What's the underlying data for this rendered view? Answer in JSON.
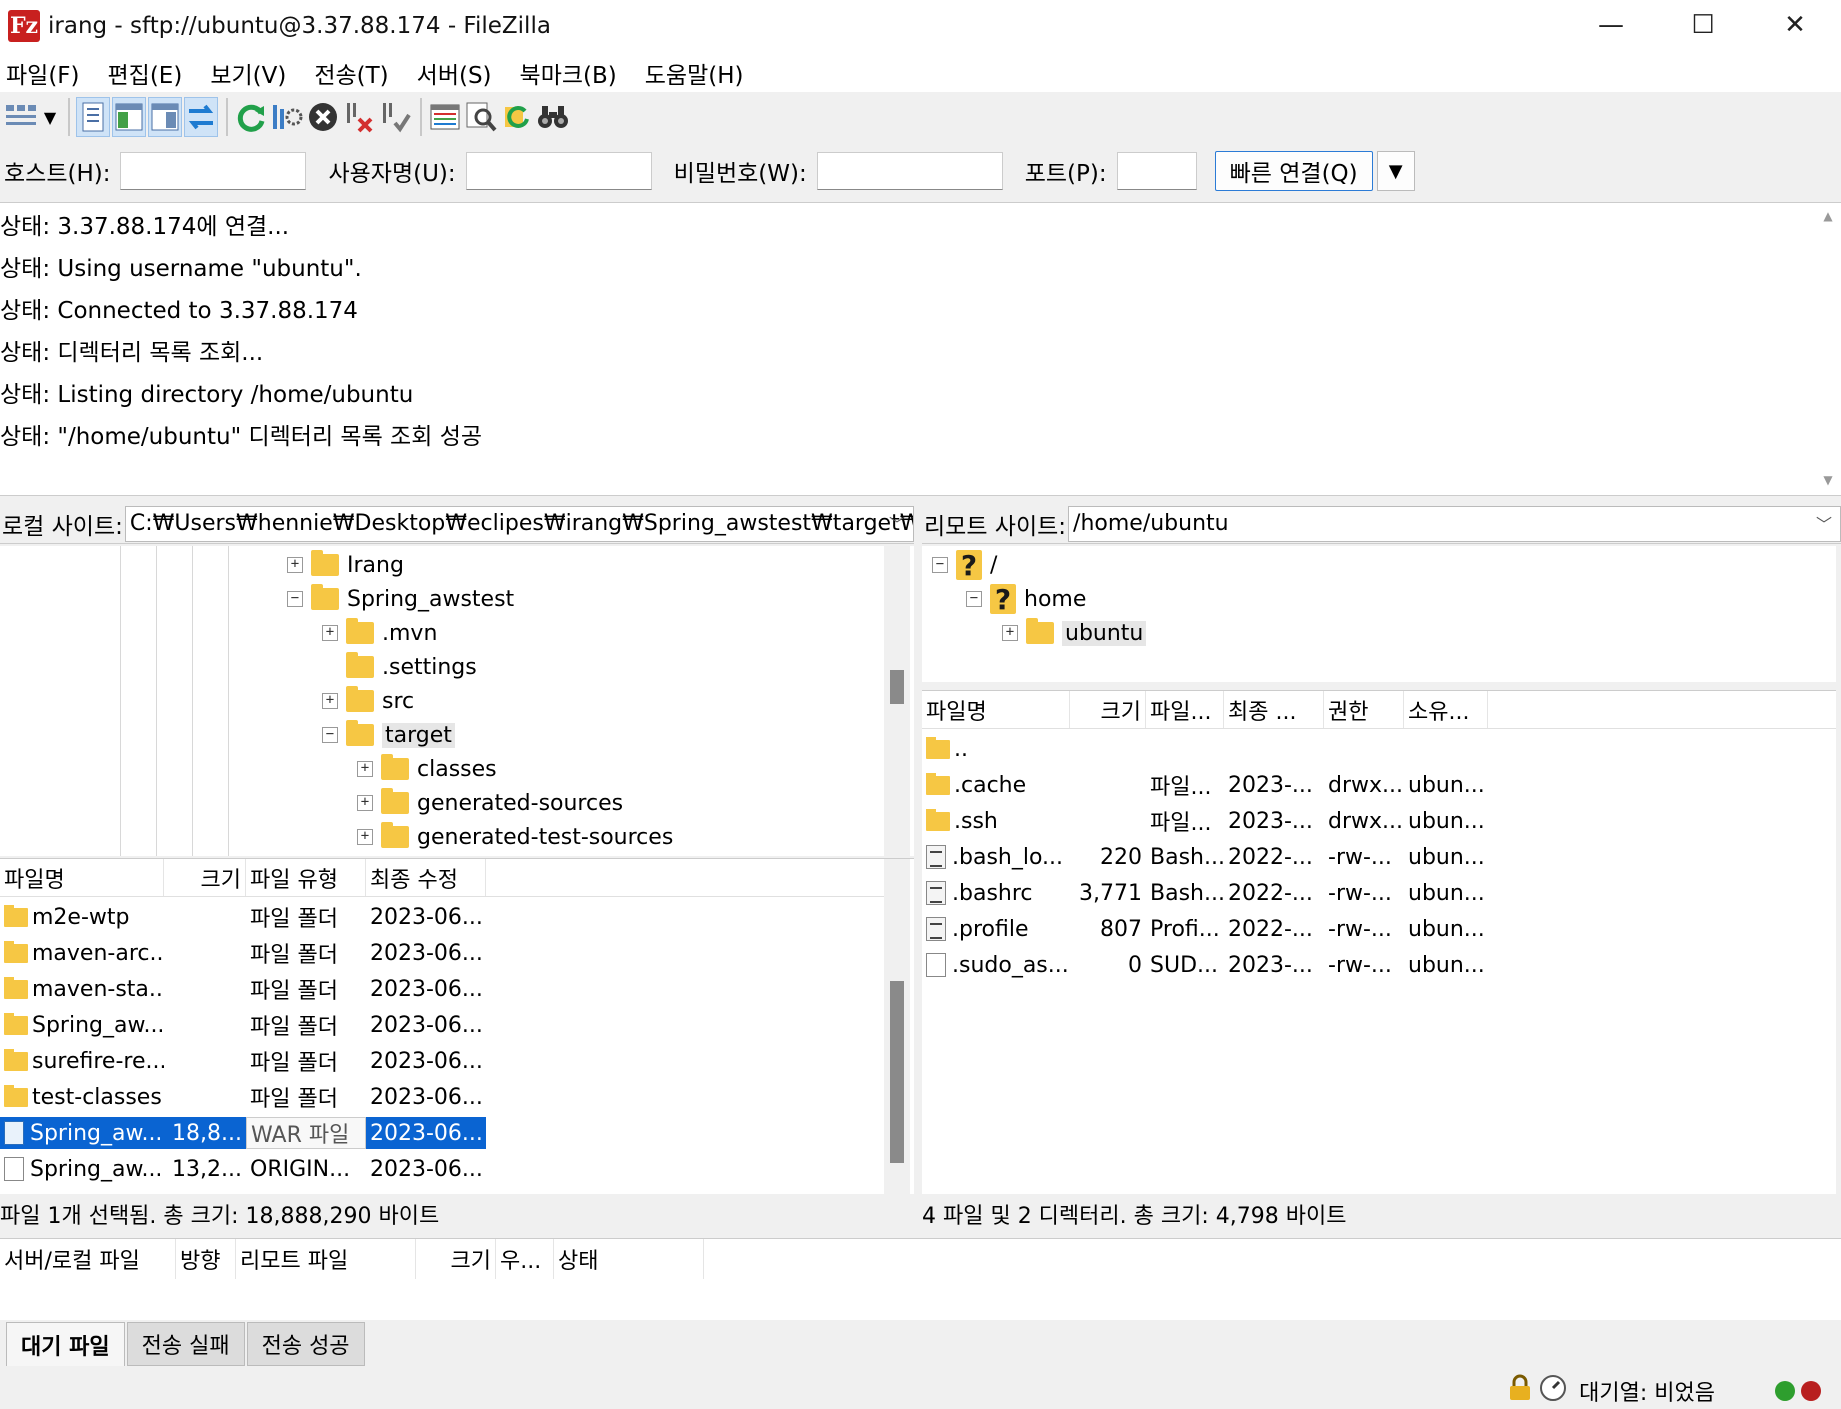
{
  "window": {
    "app_icon": "Fz",
    "title": "irang - sftp://ubuntu@3.37.88.174 - FileZilla",
    "minimize": "—",
    "maximize": "☐",
    "close": "✕"
  },
  "menu": [
    "파일(F)",
    "편집(E)",
    "보기(V)",
    "전송(T)",
    "서버(S)",
    "북마크(B)",
    "도움말(H)"
  ],
  "toolbar": {
    "icons": [
      "site-manager-icon",
      "dropdown-icon",
      "message-log-toggle-icon",
      "local-tree-toggle-icon",
      "remote-tree-toggle-icon",
      "transfer-queue-toggle-icon",
      "refresh-icon",
      "process-queue-icon",
      "cancel-icon",
      "disconnect-icon",
      "reconnect-icon",
      "directory-filter-icon",
      "toggle-comparison-icon",
      "sync-browsing-icon",
      "search-icon"
    ]
  },
  "quickconnect": {
    "host_label": "호스트(H):",
    "user_label": "사용자명(U):",
    "pass_label": "비밀번호(W):",
    "port_label": "포트(P):",
    "host_value": "",
    "user_value": "",
    "pass_value": "",
    "port_value": "",
    "button_label": "빠른 연결(Q)",
    "dropdown": "▼"
  },
  "log": [
    "상태: 3.37.88.174에 연결...",
    "상태: Using username \"ubuntu\".",
    "상태: Connected to 3.37.88.174",
    "상태: 디렉터리 목록 조회...",
    "상태: Listing directory /home/ubuntu",
    "상태: \"/home/ubuntu\" 디렉터리 목록 조회 성공"
  ],
  "local": {
    "site_label": "로컬 사이트:",
    "path": "C:₩Users₩hennie₩Desktop₩eclipes₩irang₩Spring_awstest₩target₩",
    "tree": [
      {
        "label": "Irang",
        "expander": "+"
      },
      {
        "label": "Spring_awstest",
        "expander": "−"
      },
      {
        "label": ".mvn",
        "expander": "+"
      },
      {
        "label": ".settings",
        "expander": ""
      },
      {
        "label": "src",
        "expander": "+"
      },
      {
        "label": "target",
        "expander": "−"
      },
      {
        "label": "classes",
        "expander": "+"
      },
      {
        "label": "generated-sources",
        "expander": "+"
      },
      {
        "label": "generated-test-sources",
        "expander": "+"
      }
    ],
    "columns": [
      "파일명",
      "크기",
      "파일 유형",
      "최종 수정"
    ],
    "files": [
      {
        "name": "m2e-wtp",
        "size": "",
        "type": "파일 폴더",
        "modified": "2023-06...",
        "icon": "folder"
      },
      {
        "name": "maven-arc...",
        "size": "",
        "type": "파일 폴더",
        "modified": "2023-06...",
        "icon": "folder"
      },
      {
        "name": "maven-sta...",
        "size": "",
        "type": "파일 폴더",
        "modified": "2023-06...",
        "icon": "folder"
      },
      {
        "name": "Spring_aw...",
        "size": "",
        "type": "파일 폴더",
        "modified": "2023-06...",
        "icon": "folder"
      },
      {
        "name": "surefire-re...",
        "size": "",
        "type": "파일 폴더",
        "modified": "2023-06...",
        "icon": "folder"
      },
      {
        "name": "test-classes",
        "size": "",
        "type": "파일 폴더",
        "modified": "2023-06...",
        "icon": "folder"
      },
      {
        "name": "Spring_aw...",
        "size": "18,8...",
        "type": "WAR 파일",
        "modified": "2023-06...",
        "icon": "war-file",
        "selected": true
      },
      {
        "name": "Spring_aw...",
        "size": "13,2...",
        "type": "ORIGIN...",
        "modified": "2023-06...",
        "icon": "file"
      }
    ],
    "status": "파일 1개 선택됨. 총 크기: 18,888,290 바이트"
  },
  "remote": {
    "site_label": "리모트 사이트:",
    "path": "/home/ubuntu",
    "tree": [
      {
        "label": "/",
        "expander": "−",
        "icon": "unknown"
      },
      {
        "label": "home",
        "expander": "−",
        "icon": "unknown"
      },
      {
        "label": "ubuntu",
        "expander": "+",
        "icon": "folder"
      }
    ],
    "columns": [
      "파일명",
      "크기",
      "파일...",
      "최종 ...",
      "권한",
      "소유..."
    ],
    "files": [
      {
        "name": "..",
        "size": "",
        "type": "",
        "modified": "",
        "perm": "",
        "owner": "",
        "icon": "folder"
      },
      {
        "name": ".cache",
        "size": "",
        "type": "파일...",
        "modified": "2023-...",
        "perm": "drwx...",
        "owner": "ubun...",
        "icon": "folder"
      },
      {
        "name": ".ssh",
        "size": "",
        "type": "파일...",
        "modified": "2023-...",
        "perm": "drwx...",
        "owner": "ubun...",
        "icon": "folder"
      },
      {
        "name": ".bash_lo...",
        "size": "220",
        "type": "Bash...",
        "modified": "2022-...",
        "perm": "-rw-...",
        "owner": "ubun...",
        "icon": "text-file"
      },
      {
        "name": ".bashrc",
        "size": "3,771",
        "type": "Bash...",
        "modified": "2022-...",
        "perm": "-rw-...",
        "owner": "ubun...",
        "icon": "text-file"
      },
      {
        "name": ".profile",
        "size": "807",
        "type": "Profi...",
        "modified": "2022-...",
        "perm": "-rw-...",
        "owner": "ubun...",
        "icon": "text-file"
      },
      {
        "name": ".sudo_as...",
        "size": "0",
        "type": "SUD...",
        "modified": "2023-...",
        "perm": "-rw-...",
        "owner": "ubun...",
        "icon": "file"
      }
    ],
    "status": "4 파일 및 2 디렉터리. 총 크기: 4,798 바이트"
  },
  "queue": {
    "columns": [
      "서버/로컬 파일",
      "방향",
      "리모트 파일",
      "크기",
      "우...",
      "상태"
    ],
    "tabs": [
      "대기 파일",
      "전송 실패",
      "전송 성공"
    ],
    "active_tab": "대기 파일",
    "status": "대기열: 비었음"
  },
  "colors": {
    "selection": "#0a64d2",
    "folder": "#f6c744",
    "led_green": "#2e9e2e",
    "led_red": "#b81f1f"
  }
}
